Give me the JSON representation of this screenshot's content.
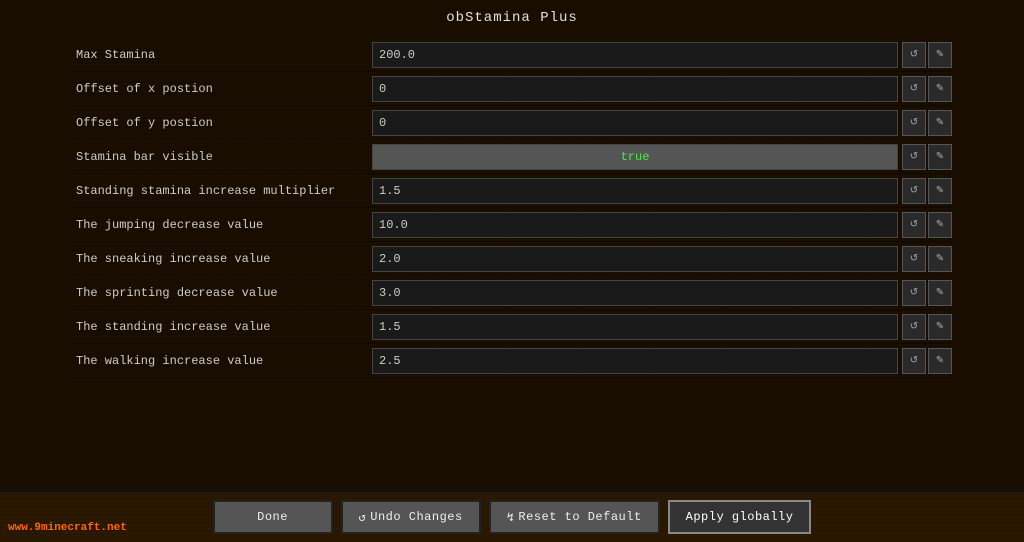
{
  "title": "obStamina Plus",
  "settings": [
    {
      "id": "max-stamina",
      "label": "Max Stamina",
      "value": "200.0",
      "type": "number"
    },
    {
      "id": "offset-x",
      "label": "Offset of x postion",
      "value": "0",
      "type": "number"
    },
    {
      "id": "offset-y",
      "label": "Offset of y postion",
      "value": "0",
      "type": "number"
    },
    {
      "id": "stamina-visible",
      "label": "Stamina bar visible",
      "value": "true",
      "type": "boolean"
    },
    {
      "id": "standing-multiplier",
      "label": "Standing stamina increase multiplier",
      "value": "1.5",
      "type": "number"
    },
    {
      "id": "jumping-decrease",
      "label": "The jumping decrease value",
      "value": "10.0",
      "type": "number"
    },
    {
      "id": "sneaking-increase",
      "label": "The sneaking increase value",
      "value": "2.0",
      "type": "number"
    },
    {
      "id": "sprinting-decrease",
      "label": "The sprinting decrease value",
      "value": "3.0",
      "type": "number"
    },
    {
      "id": "standing-increase",
      "label": "The standing increase value",
      "value": "1.5",
      "type": "number"
    },
    {
      "id": "walking-increase",
      "label": "The walking increase value",
      "value": "2.5",
      "type": "number"
    }
  ],
  "buttons": {
    "done": "Done",
    "undo": "Undo Changes",
    "reset": "Reset to Default",
    "apply": "Apply globally"
  },
  "icons": {
    "undo_symbol": "↺",
    "reset_symbol": "↯",
    "row_reset": "↺",
    "row_edit": "✎"
  },
  "watermark": {
    "prefix": "www.",
    "site": "9minecraft",
    "suffix": ".net"
  }
}
